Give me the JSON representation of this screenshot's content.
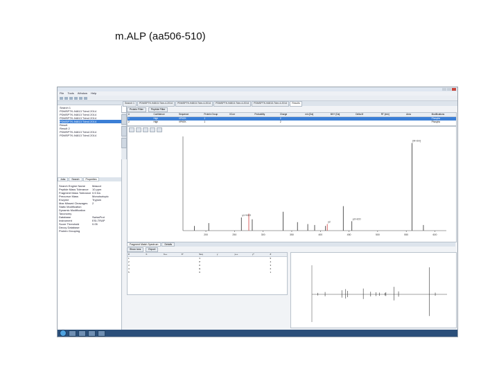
{
  "slide": {
    "title": "m.ALP (aa506-510)"
  },
  "window": {
    "menu": [
      "File",
      "Tools",
      "Window",
      "Help"
    ],
    "doc_tabs": [
      "Search 1",
      "PDMSPTK-94813-Tdm-4-2014",
      "PDMSPTK-94813-Tdm-4-2014",
      "PDMSPTK-94813-Tdm-4-2014",
      "PDMSPTK-94813-Tdm-4-2014",
      "Results"
    ],
    "tree": [
      "Search 1",
      "PDMSPTK-94813 Tdm4 2014",
      "PDMSPTK-94813 Tdm4 2014",
      "PDMSPTK-94813 Tdm4 2014",
      "PDMSPTK-94813 Tdm4 2014",
      "Result",
      "Result 2",
      "PDMSPTK-94813 Tdm4 2014",
      "PDMSPTK-94813 Tdm4 2014"
    ],
    "panel_tabs": [
      "Jobs",
      "Search",
      "Properties"
    ],
    "properties": [
      {
        "k": "Search Engine Name",
        "v": "Mascot"
      },
      {
        "k": "Peptide Mass Tolerance",
        "v": "10 ppm"
      },
      {
        "k": "Fragment Mass Tolerance",
        "v": "0.5 Da"
      },
      {
        "k": "Precursor Mass",
        "v": "Monoisotopic"
      },
      {
        "k": "Enzyme",
        "v": "Trypsin"
      },
      {
        "k": "Max Missed Cleavages",
        "v": "2"
      },
      {
        "k": "Static Modification",
        "v": ""
      },
      {
        "k": "Dynamic Modification",
        "v": ""
      },
      {
        "k": "Taxonomy",
        "v": ""
      },
      {
        "k": "Database",
        "v": "SwissProt"
      },
      {
        "k": "Instrument",
        "v": "ESI-TRAP"
      },
      {
        "k": "Score Threshold",
        "v": "0.05"
      },
      {
        "k": "Decoy Database",
        "v": ""
      },
      {
        "k": "Protein Grouping",
        "v": ""
      }
    ],
    "sub_tool_buttons": [
      "Protein Filter",
      "Peptide Filter"
    ],
    "grid_headers": [
      "#",
      "Confidence",
      "Sequence",
      "Protein Group",
      "XCorr",
      "Probability",
      "Charge",
      "m/z [Da]",
      "MH+ [Da]",
      "Delta M",
      "RT [min]",
      "Area",
      "Modifications"
    ],
    "grid_rows": [
      [
        "1",
        "High",
        "VPKEK",
        "1",
        "",
        "",
        "2",
        "",
        "",
        "",
        "",
        "",
        "Phospho"
      ],
      [
        "2",
        "High",
        "VPKEK",
        "1",
        "",
        "",
        "2",
        "",
        "",
        "",
        "",
        "",
        "Phospho"
      ]
    ],
    "bottom_tabs": [
      "Fragment Match Spectrum",
      "Details"
    ],
    "tool2_buttons": [
      "Show Ions",
      "Export"
    ],
    "frag_headers": [
      "#",
      "b",
      "b++",
      "b*",
      "Seq",
      "y",
      "y++",
      "y*",
      "#"
    ],
    "frag_rows": [
      [
        "1",
        "",
        "",
        "",
        "V",
        "",
        "",
        "",
        "5"
      ],
      [
        "2",
        "",
        "",
        "",
        "P",
        "",
        "",
        "",
        "4"
      ],
      [
        "3",
        "",
        "",
        "",
        "K",
        "",
        "",
        "",
        "3"
      ],
      [
        "4",
        "",
        "",
        "",
        "E",
        "",
        "",
        "",
        "2"
      ],
      [
        "5",
        "",
        "",
        "",
        "K",
        "",
        "",
        "",
        "1"
      ]
    ],
    "clock": {
      "time": "",
      "date": ""
    }
  },
  "chart_data": {
    "type": "bar",
    "title": "",
    "xlabel": "",
    "ylabel": "",
    "x": [
      180,
      205,
      262,
      275,
      281,
      335,
      360,
      378,
      390,
      409,
      412,
      440,
      455,
      560,
      580
    ],
    "values": [
      5,
      8,
      14,
      18,
      12,
      20,
      9,
      7,
      6,
      5,
      7,
      26,
      10,
      93,
      6
    ],
    "xlim": [
      160,
      620
    ],
    "ylim": [
      0,
      100
    ],
    "annotations": [
      {
        "x": 262,
        "label": "y1+H2O"
      },
      {
        "x": 335,
        "label": ""
      },
      {
        "x": 412,
        "label": "y2"
      },
      {
        "x": 440,
        "label": ""
      },
      {
        "x": 455,
        "label": "y3 H2O"
      },
      {
        "x": 560,
        "label": "[M+2H]"
      }
    ],
    "grid": false,
    "legend": "none",
    "color": "#2b2b2b",
    "highlight_color": "#d23c3c"
  }
}
